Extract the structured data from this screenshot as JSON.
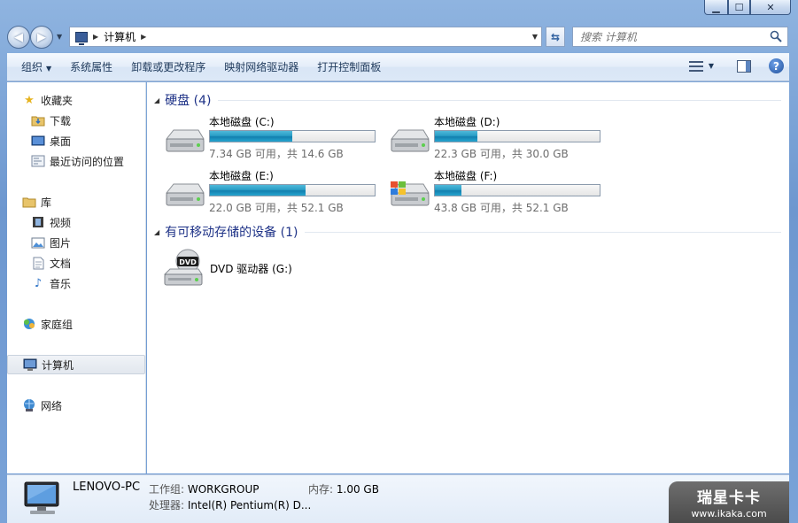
{
  "window": {
    "minimize": "▁",
    "maximize": "☐",
    "close": "✕"
  },
  "address": {
    "segment": "计算机"
  },
  "search": {
    "placeholder": "搜索 计算机"
  },
  "toolbar": {
    "organize": "组织",
    "items": [
      "系统属性",
      "卸载或更改程序",
      "映射网络驱动器",
      "打开控制面板"
    ],
    "help": "?"
  },
  "sidebar": {
    "favorites": "收藏夹",
    "favorites_items": [
      "下载",
      "桌面",
      "最近访问的位置"
    ],
    "libraries": "库",
    "library_items": [
      "视频",
      "图片",
      "文档",
      "音乐"
    ],
    "homegroup": "家庭组",
    "computer": "计算机",
    "network": "网络"
  },
  "groups": {
    "hard_disks": "硬盘 (4)",
    "removable": "有可移动存储的设备 (1)"
  },
  "drives": [
    {
      "name": "本地磁盘 (C:)",
      "info": "7.34 GB 可用，共 14.6 GB",
      "used_fraction": 0.5
    },
    {
      "name": "本地磁盘 (D:)",
      "info": "22.3 GB 可用，共 30.0 GB",
      "used_fraction": 0.26
    },
    {
      "name": "本地磁盘 (E:)",
      "info": "22.0 GB 可用，共 52.1 GB",
      "used_fraction": 0.58
    },
    {
      "name": "本地磁盘 (F:)",
      "info": "43.8 GB 可用，共 52.1 GB",
      "used_fraction": 0.16
    }
  ],
  "dvd": {
    "name": "DVD 驱动器 (G:)",
    "badge": "DVD"
  },
  "status": {
    "pc_name": "LENOVO-PC",
    "workgroup_label": "工作组:",
    "workgroup_value": "WORKGROUP",
    "memory_label": "内存:",
    "memory_value": "1.00 GB",
    "cpu_label": "处理器:",
    "cpu_value": "Intel(R) Pentium(R) D..."
  },
  "watermark": {
    "brand": "瑞星卡卡",
    "url": "www.ikaka.com"
  },
  "colors": {
    "accent": "#1e3287",
    "bar_fill": "#2a9ec6",
    "window_glass": "#8fb4e0"
  }
}
